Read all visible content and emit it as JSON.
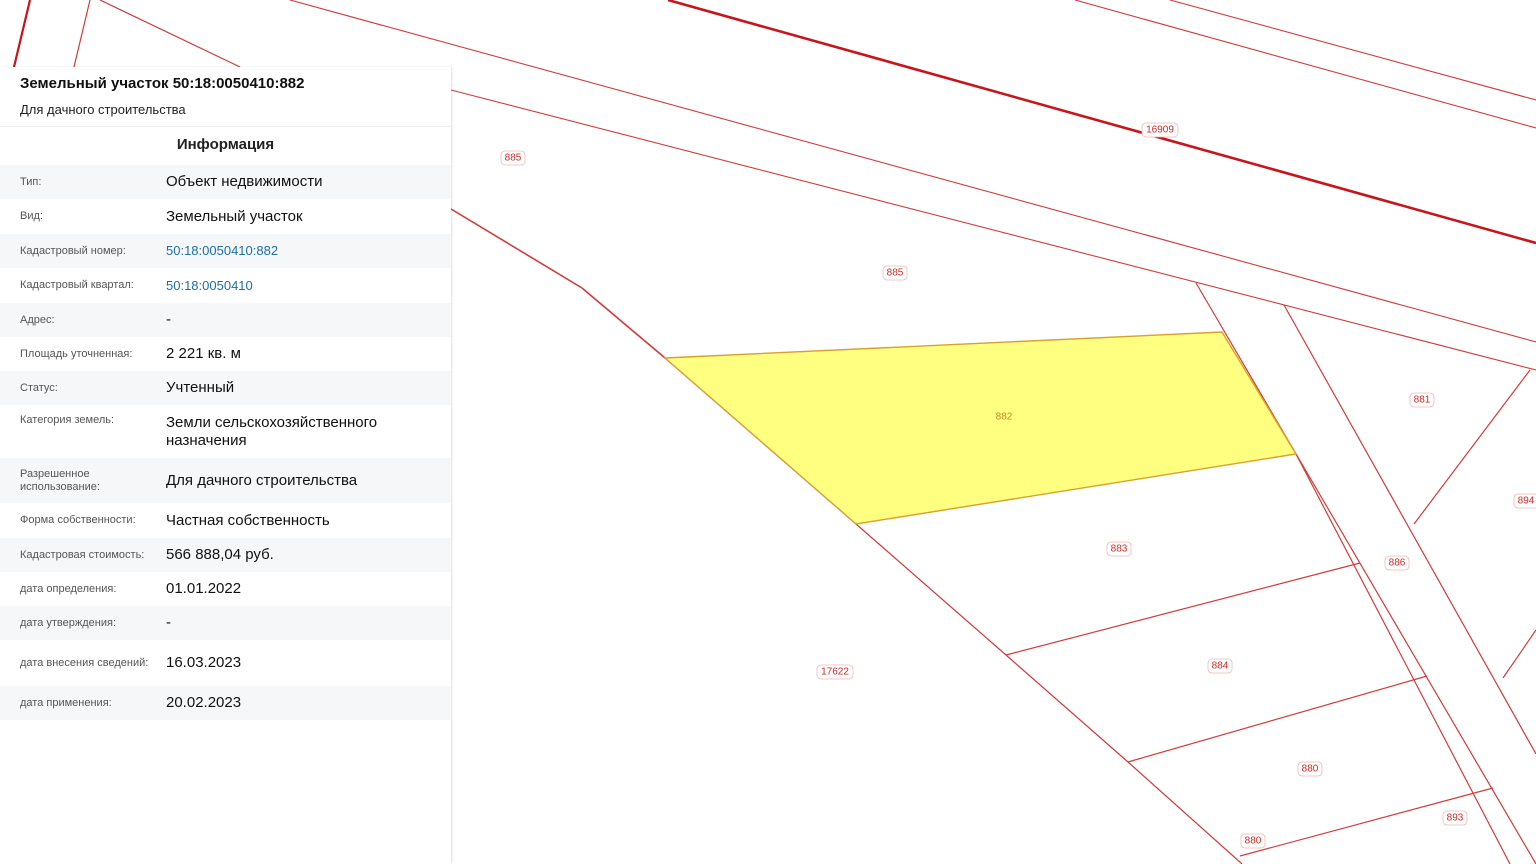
{
  "parcel_card": {
    "title": "Земельный участок 50:18:0050410:882",
    "subtitle": "Для дачного строительства",
    "section_title": "Информация",
    "rows": [
      {
        "label": "Тип:",
        "value": "Объект недвижимости",
        "is_link": false
      },
      {
        "label": "Вид:",
        "value": "Земельный участок",
        "is_link": false
      },
      {
        "label": "Кадастровый номер:",
        "value": "50:18:0050410:882",
        "is_link": true
      },
      {
        "label": "Кадастровый квартал:",
        "value": "50:18:0050410",
        "is_link": true
      },
      {
        "label": "Адрес:",
        "value": "-",
        "is_link": false
      },
      {
        "label": "Площадь уточненная:",
        "value": "2 221 кв. м",
        "is_link": false
      },
      {
        "label": "Статус:",
        "value": "Учтенный",
        "is_link": false
      },
      {
        "label": "Категория земель:",
        "value": "Земли сельскохозяйственного назначения",
        "is_link": false
      },
      {
        "label": "Разрешенное использование:",
        "value": "Для дачного строительства",
        "is_link": false
      },
      {
        "label": "Форма собственности:",
        "value": "Частная собственность",
        "is_link": false
      },
      {
        "label": "Кадастровая стоимость:",
        "value": "566 888,04 руб.",
        "is_link": false
      },
      {
        "label": "дата определения:",
        "value": "01.01.2022",
        "is_link": false
      },
      {
        "label": "дата утверждения:",
        "value": "-",
        "is_link": false
      },
      {
        "label": "дата внесения сведений:",
        "value": "16.03.2023",
        "is_link": false
      },
      {
        "label": "дата применения:",
        "value": "20.02.2023",
        "is_link": false
      }
    ]
  },
  "map": {
    "selected_parcel": "882",
    "parcel_labels": [
      "885",
      "885",
      "16909",
      "882",
      "881",
      "894",
      "883",
      "886",
      "17622",
      "884",
      "880",
      "893",
      "880"
    ],
    "colors": {
      "boundary": "#d23b3b",
      "major_boundary": "#c8141a",
      "selected_fill": "#ffff80",
      "selected_stroke": "#d9a030",
      "link": "#1d6fa5"
    }
  }
}
